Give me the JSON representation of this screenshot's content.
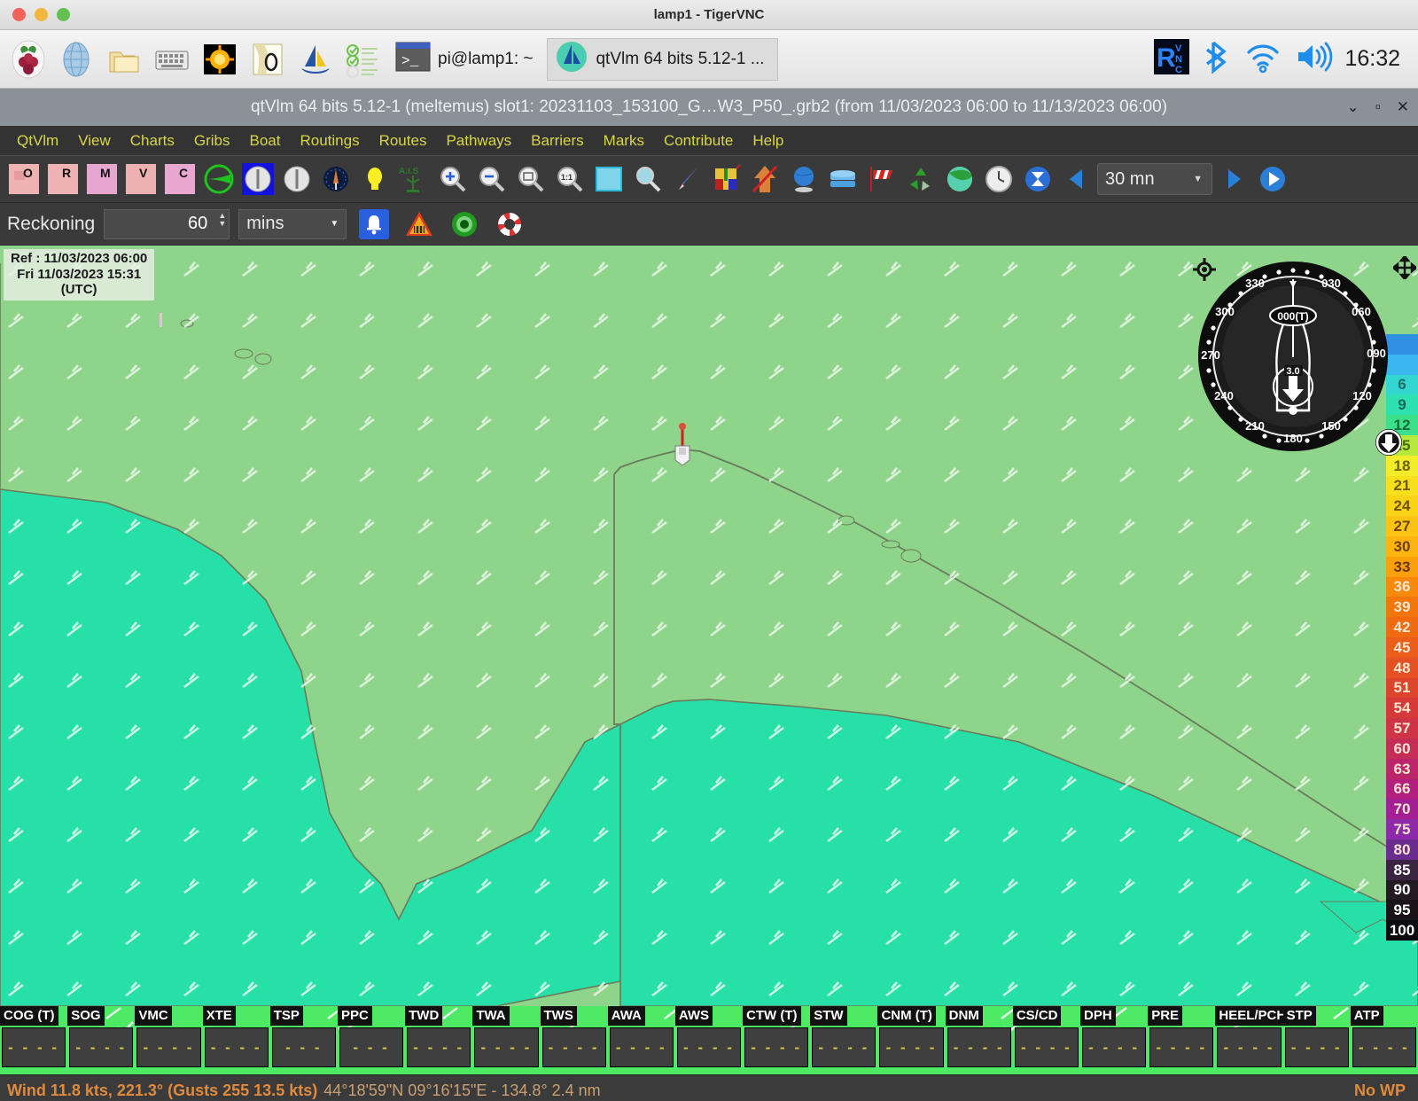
{
  "desktop": {
    "window_title": "lamp1 - TigerVNC",
    "launcher_icons": [
      {
        "name": "raspberry-menu-icon",
        "glyph": "raspberry"
      },
      {
        "name": "web-browser-icon",
        "glyph": "globe"
      },
      {
        "name": "file-manager-icon",
        "glyph": "folders"
      },
      {
        "name": "virtual-keyboard-icon",
        "glyph": "keyboard"
      },
      {
        "name": "sun-app-icon",
        "glyph": "sun"
      },
      {
        "name": "zygrib-icon",
        "glyph": "map-o"
      },
      {
        "name": "sailing-app-icon",
        "glyph": "sail"
      },
      {
        "name": "task-list-icon",
        "glyph": "checklist"
      }
    ],
    "taskbar_buttons": [
      {
        "name": "taskbar-terminal",
        "label": "pi@lamp1: ~",
        "icon": "terminal-icon"
      },
      {
        "name": "taskbar-qtvlm",
        "label": "qtVlm 64 bits 5.12-1 ...",
        "icon": "qtvlm-icon"
      }
    ],
    "tray": [
      {
        "name": "vnc-tray-icon",
        "glyph": "RVNC"
      },
      {
        "name": "bluetooth-tray-icon",
        "glyph": "bluetooth"
      },
      {
        "name": "wifi-tray-icon",
        "glyph": "wifi"
      },
      {
        "name": "volume-tray-icon",
        "glyph": "speaker"
      }
    ],
    "clock": "16:32"
  },
  "qtvlm": {
    "title": "qtVlm 64 bits 5.12-1 (meltemus) slot1: 20231103_153100_G…W3_P50_.grb2 (from 11/03/2023 06:00 to 11/13/2023 06:00)",
    "window_controls": {
      "minimize": "⌄",
      "maximize": "▫",
      "close": "✕"
    },
    "menu": [
      "QtVlm",
      "View",
      "Charts",
      "Gribs",
      "Boat",
      "Routings",
      "Routes",
      "Pathways",
      "Barriers",
      "Marks",
      "Contribute",
      "Help"
    ],
    "toolbar": {
      "grib_letters": [
        "O",
        "R",
        "M",
        "V",
        "C"
      ],
      "time_step": "30 mn",
      "icons": [
        "grib-o-icon",
        "grib-r-icon",
        "grib-m-icon",
        "grib-v-icon",
        "grib-c-icon",
        "polar-icon",
        "compass-blue-icon",
        "compass-icon",
        "instrument-icon",
        "lightbulb-icon",
        "ais-icon",
        "zoom-in-icon",
        "zoom-out-icon",
        "zoom-fit-icon",
        "zoom-1-1-icon",
        "square-select-icon",
        "zoom-area-icon",
        "pointer-icon",
        "gate-icon",
        "no-entry-arrow-icon",
        "globe-icon",
        "layers-icon",
        "windsock-icon",
        "recycle-icon",
        "palette-icon",
        "clock-icon",
        "hourglass-icon",
        "prev-step-icon",
        "next-step-icon",
        "play-icon"
      ]
    },
    "toolbar2": {
      "reckoning_label": "Reckoning",
      "reckoning_value": "60",
      "reckoning_unit": "mins",
      "icons": [
        "alarm-bell-icon",
        "warning-triangle-icon",
        "target-icon",
        "lifebuoy-icon"
      ]
    }
  },
  "map": {
    "ref_line1": "Ref : 11/03/2023 06:00",
    "ref_line2": "Fri 11/03/2023 15:31",
    "ref_line3": "(UTC)",
    "compass": {
      "heading_label": "000(T)",
      "speed_label": "3.0",
      "ticks": [
        "030",
        "060",
        "090",
        "120",
        "150",
        "180",
        "210",
        "240",
        "270",
        "300",
        "330"
      ]
    },
    "icons": {
      "center_target": "crosshair-icon",
      "move_handle": "move-icon",
      "scale_knob": "scale-knob-icon"
    },
    "colors": {
      "land": "#8ed48a",
      "sea": "#27e0a8",
      "coastline": "#6b7a5c"
    },
    "wind_scale": [
      {
        "label": "",
        "color": "#2f8fe0"
      },
      {
        "label": "",
        "color": "#3cb6ef"
      },
      {
        "label": "6",
        "color": "#33d6d0",
        "text": "#1d6b66"
      },
      {
        "label": "9",
        "color": "#2fe0b3",
        "text": "#12685a"
      },
      {
        "label": "12",
        "color": "#3ce08a",
        "text": "#156b3b"
      },
      {
        "label": "15",
        "color": "#b7e83c",
        "text": "#4c6b0f"
      },
      {
        "label": "18",
        "color": "#f2ec2a",
        "text": "#6b6208"
      },
      {
        "label": "21",
        "color": "#f7e01b",
        "text": "#6f5a06"
      },
      {
        "label": "24",
        "color": "#f9d317",
        "text": "#6f5206"
      },
      {
        "label": "27",
        "color": "#fbc313",
        "text": "#6f4805"
      },
      {
        "label": "30",
        "color": "#fcb40f",
        "text": "#6f3f05"
      },
      {
        "label": "33",
        "color": "#fba00d",
        "text": "#6d3604"
      },
      {
        "label": "36",
        "color": "#f8890c",
        "text": "#fde6cf"
      },
      {
        "label": "39",
        "color": "#f3760d",
        "text": "#fde6cf"
      },
      {
        "label": "42",
        "color": "#ef6a12",
        "text": "#fde6cf"
      },
      {
        "label": "45",
        "color": "#ea5d1a",
        "text": "#fde6cf"
      },
      {
        "label": "48",
        "color": "#e45122",
        "text": "#fde6cf"
      },
      {
        "label": "51",
        "color": "#dd442c",
        "text": "#fde6cf"
      },
      {
        "label": "54",
        "color": "#d53a38",
        "text": "#fde6cf"
      },
      {
        "label": "57",
        "color": "#ce3346",
        "text": "#fde6cf"
      },
      {
        "label": "60",
        "color": "#c52c58",
        "text": "#fde6cf"
      },
      {
        "label": "63",
        "color": "#bd256a",
        "text": "#fde6cf"
      },
      {
        "label": "66",
        "color": "#b31f7d",
        "text": "#fde6cf"
      },
      {
        "label": "70",
        "color": "#a41e94",
        "text": "#fde6cf"
      },
      {
        "label": "75",
        "color": "#8c2aa8",
        "text": "#fde6cf"
      },
      {
        "label": "80",
        "color": "#6a2c8f",
        "text": "#fde6cf"
      },
      {
        "label": "85",
        "color": "#3a2440",
        "text": "#ffffff"
      },
      {
        "label": "90",
        "color": "#231a24",
        "text": "#ffffff"
      },
      {
        "label": "95",
        "color": "#1a1418",
        "text": "#ffffff"
      },
      {
        "label": "100",
        "color": "#0e0b0e",
        "text": "#ffffff"
      }
    ]
  },
  "data_panel": {
    "columns": [
      {
        "header": "COG (T)",
        "value": "- - - -"
      },
      {
        "header": "SOG",
        "value": "- - - -"
      },
      {
        "header": "VMC",
        "value": "- - - -"
      },
      {
        "header": "XTE",
        "value": "- - - -"
      },
      {
        "header": "TSP",
        "value": "- - -"
      },
      {
        "header": "PPC",
        "value": "- - -"
      },
      {
        "header": "TWD",
        "value": "- - - -"
      },
      {
        "header": "TWA",
        "value": "- - - -"
      },
      {
        "header": "TWS",
        "value": "- - - -"
      },
      {
        "header": "AWA",
        "value": "- - - -"
      },
      {
        "header": "AWS",
        "value": "- - - -"
      },
      {
        "header": "CTW (T)",
        "value": "- - - -"
      },
      {
        "header": "STW",
        "value": "- - - -"
      },
      {
        "header": "CNM (T)",
        "value": "- - - -"
      },
      {
        "header": "DNM",
        "value": "- - - -"
      },
      {
        "header": "CS/CD",
        "value": "- - - -"
      },
      {
        "header": "DPH",
        "value": "- - - -"
      },
      {
        "header": "PRE",
        "value": "- - - -"
      },
      {
        "header": "HEEL/PCH",
        "value": "- - - -"
      },
      {
        "header": "STP",
        "value": "- - - -"
      },
      {
        "header": "ATP",
        "value": "- - - -"
      }
    ]
  },
  "status_bar": {
    "wind": "Wind 11.8 kts, 221.3° (Gusts 255 13.5 kts)",
    "position": "44°18'59\"N 09°16'15\"E - 134.8° 2.4 nm",
    "right": "No WP"
  }
}
